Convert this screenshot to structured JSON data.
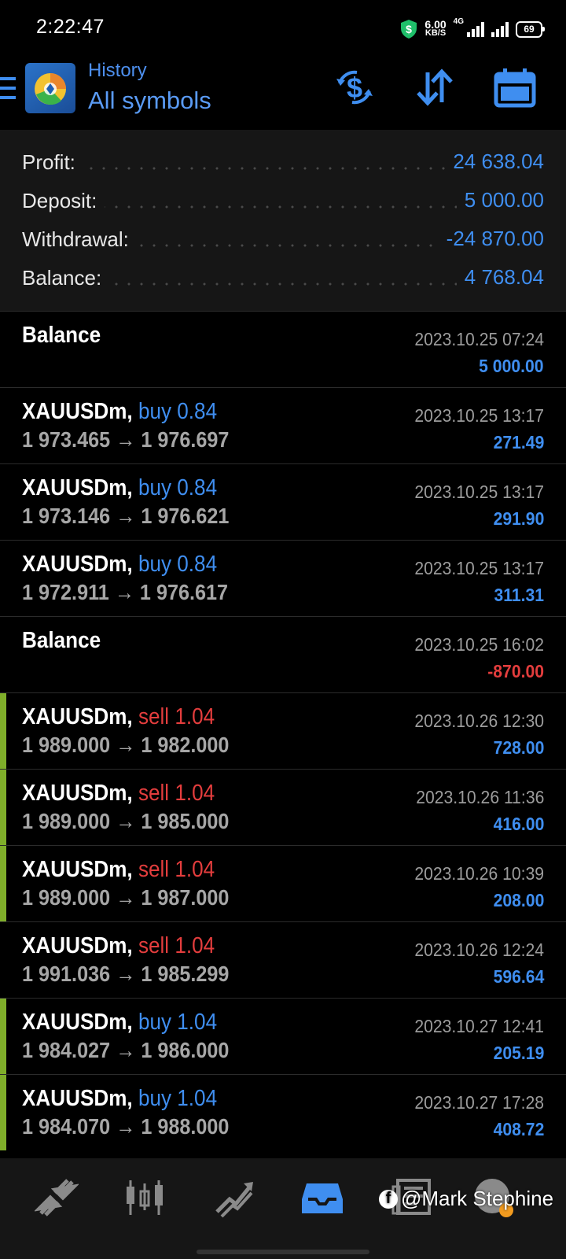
{
  "status_bar": {
    "time": "2:22:47",
    "net_speed_value": "6.00",
    "net_speed_unit": "KB/S",
    "network_type": "4G",
    "battery": "69"
  },
  "header": {
    "section": "History",
    "filter": "All symbols",
    "icons": [
      "menu-icon",
      "app-logo",
      "currency-exchange-icon",
      "sort-icon",
      "calendar-icon"
    ]
  },
  "summary": [
    {
      "label": "Profit:",
      "value": "24 638.04"
    },
    {
      "label": "Deposit:",
      "value": "5 000.00"
    },
    {
      "label": "Withdrawal:",
      "value": "-24 870.00"
    },
    {
      "label": "Balance:",
      "value": "4 768.04"
    }
  ],
  "deals": [
    {
      "kind": "balance",
      "title": "Balance",
      "date": "2023.10.25 07:24",
      "amount": "5 000.00",
      "negative": false,
      "green": false
    },
    {
      "kind": "trade",
      "symbol": "XAUUSDm,",
      "side": "buy",
      "volume": "0.84",
      "open": "1 973.465",
      "close": "1 976.697",
      "date": "2023.10.25 13:17",
      "amount": "271.49",
      "negative": false,
      "green": false
    },
    {
      "kind": "trade",
      "symbol": "XAUUSDm,",
      "side": "buy",
      "volume": "0.84",
      "open": "1 973.146",
      "close": "1 976.621",
      "date": "2023.10.25 13:17",
      "amount": "291.90",
      "negative": false,
      "green": false
    },
    {
      "kind": "trade",
      "symbol": "XAUUSDm,",
      "side": "buy",
      "volume": "0.84",
      "open": "1 972.911",
      "close": "1 976.617",
      "date": "2023.10.25 13:17",
      "amount": "311.31",
      "negative": false,
      "green": false
    },
    {
      "kind": "balance",
      "title": "Balance",
      "date": "2023.10.25 16:02",
      "amount": "-870.00",
      "negative": true,
      "green": false
    },
    {
      "kind": "trade",
      "symbol": "XAUUSDm,",
      "side": "sell",
      "volume": "1.04",
      "open": "1 989.000",
      "close": "1 982.000",
      "date": "2023.10.26 12:30",
      "amount": "728.00",
      "negative": false,
      "green": true
    },
    {
      "kind": "trade",
      "symbol": "XAUUSDm,",
      "side": "sell",
      "volume": "1.04",
      "open": "1 989.000",
      "close": "1 985.000",
      "date": "2023.10.26 11:36",
      "amount": "416.00",
      "negative": false,
      "green": true
    },
    {
      "kind": "trade",
      "symbol": "XAUUSDm,",
      "side": "sell",
      "volume": "1.04",
      "open": "1 989.000",
      "close": "1 987.000",
      "date": "2023.10.26 10:39",
      "amount": "208.00",
      "negative": false,
      "green": true
    },
    {
      "kind": "trade",
      "symbol": "XAUUSDm,",
      "side": "sell",
      "volume": "1.04",
      "open": "1 991.036",
      "close": "1 985.299",
      "date": "2023.10.26 12:24",
      "amount": "596.64",
      "negative": false,
      "green": false
    },
    {
      "kind": "trade",
      "symbol": "XAUUSDm,",
      "side": "buy",
      "volume": "1.04",
      "open": "1 984.027",
      "close": "1 986.000",
      "date": "2023.10.27 12:41",
      "amount": "205.19",
      "negative": false,
      "green": true
    },
    {
      "kind": "trade",
      "symbol": "XAUUSDm,",
      "side": "buy",
      "volume": "1.04",
      "open": "1 984.070",
      "close": "1 988.000",
      "date": "2023.10.27 17:28",
      "amount": "408.72",
      "negative": false,
      "green": true
    }
  ],
  "arrow": "→",
  "bottom_nav": {
    "items": [
      "quotes-icon",
      "chart-icon",
      "trade-icon",
      "history-icon",
      "news-icon",
      "messages-icon"
    ],
    "active": "history-icon"
  },
  "watermark": {
    "text": "@Mark Stephine",
    "logo_letter": "f"
  },
  "colors": {
    "accent": "#3f8ef0",
    "negative": "#e33d3d",
    "closed_marker": "#7fae2a"
  }
}
